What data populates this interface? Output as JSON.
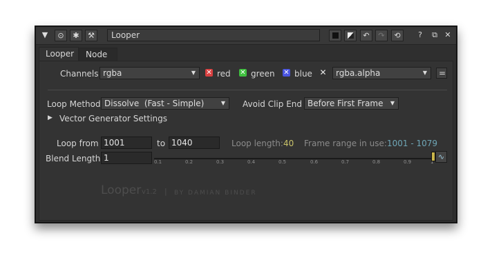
{
  "titlebar": {
    "node_name": "Looper",
    "icons": [
      "collapse-triangle-icon",
      "node-settings-icon",
      "bug-icon",
      "wrench-icon",
      "black-swatch-icon",
      "white-swatch-icon",
      "undo-icon",
      "redo-icon",
      "revert-icon",
      "help-icon",
      "float-icon",
      "close-icon"
    ]
  },
  "tabs": [
    {
      "label": "Looper",
      "active": true
    },
    {
      "label": "Node",
      "active": false
    }
  ],
  "channels": {
    "label": "Channels",
    "value": "rgba",
    "red": "red",
    "green": "green",
    "blue": "blue",
    "alpha_value": "rgba.alpha",
    "equals": "="
  },
  "loop_method": {
    "label": "Loop Method",
    "value": "Dissolve  (Fast - Simple)"
  },
  "avoid_clip_end": {
    "label": "Avoid Clip End",
    "value": "Before First Frame"
  },
  "vector_group": {
    "label": "Vector Generator Settings"
  },
  "loop_range": {
    "from_label": "Loop from",
    "from_value": "1001",
    "to_label": "to",
    "to_value": "1040",
    "length_label": "Loop length:",
    "length_value": "40",
    "frame_range_label": "Frame range in use:",
    "frame_range_value": "1001 - 1079"
  },
  "blend": {
    "label": "Blend Length",
    "value": "1",
    "slider_value": 1.0,
    "ticks": [
      "0.1",
      "0.2",
      "0.3",
      "0.4",
      "0.5",
      "0.6",
      "0.7",
      "0.8",
      "0.9",
      "1"
    ]
  },
  "branding": {
    "title": "Looper",
    "version": "v1.2",
    "divider": "|",
    "author": "BY DAMIAN BINDER"
  },
  "colors": {
    "red_check": "#d94040",
    "green_check": "#3fbf3f",
    "blue_check": "#4a55e0",
    "length_value": "#c9c26a",
    "frame_range_value": "#6fa6b6"
  }
}
